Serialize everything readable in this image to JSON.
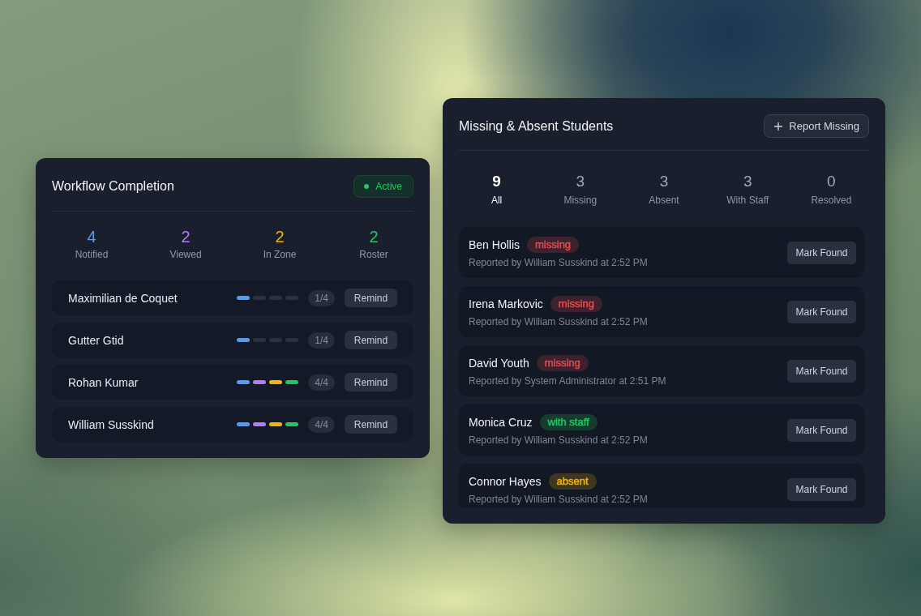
{
  "workflow": {
    "title": "Workflow Completion",
    "status": {
      "label": "Active"
    },
    "stats": [
      {
        "value": "4",
        "label": "Notified",
        "color": "#4f9df8"
      },
      {
        "value": "2",
        "label": "Viewed",
        "color": "#b07cf4"
      },
      {
        "value": "2",
        "label": "In Zone",
        "color": "#f2b20c"
      },
      {
        "value": "2",
        "label": "Roster",
        "color": "#1fc862"
      }
    ],
    "rows": [
      {
        "name": "Maximilian de Coquet",
        "steps": [
          {
            "done": true
          },
          {
            "done": false
          },
          {
            "done": false
          },
          {
            "done": false
          }
        ],
        "progress": "1/4",
        "action": "Remind"
      },
      {
        "name": "Gutter Gtid",
        "steps": [
          {
            "done": true
          },
          {
            "done": false
          },
          {
            "done": false
          },
          {
            "done": false
          }
        ],
        "progress": "1/4",
        "action": "Remind"
      },
      {
        "name": "Rohan Kumar",
        "steps": [
          {
            "done": true
          },
          {
            "done": true
          },
          {
            "done": true
          },
          {
            "done": true
          }
        ],
        "progress": "4/4",
        "action": "Remind"
      },
      {
        "name": "William Susskind",
        "steps": [
          {
            "done": true
          },
          {
            "done": true
          },
          {
            "done": true
          },
          {
            "done": true
          }
        ],
        "progress": "4/4",
        "action": "Remind"
      }
    ]
  },
  "students": {
    "title": "Missing & Absent Students",
    "action": "Report Missing",
    "filters": [
      {
        "count": "9",
        "label": "All",
        "selected": true
      },
      {
        "count": "3",
        "label": "Missing",
        "selected": false
      },
      {
        "count": "3",
        "label": "Absent",
        "selected": false
      },
      {
        "count": "3",
        "label": "With Staff",
        "selected": false
      },
      {
        "count": "0",
        "label": "Resolved",
        "selected": false
      }
    ],
    "rows": [
      {
        "name": "Ben Hollis",
        "tag": {
          "label": "missing",
          "color": "#e5484d"
        },
        "reported": "Reported by William Susskind at 2:52 PM",
        "action": "Mark Found"
      },
      {
        "name": "Irena Markovic",
        "tag": {
          "label": "missing",
          "color": "#e5484d"
        },
        "reported": "Reported by William Susskind at 2:52 PM",
        "action": "Mark Found"
      },
      {
        "name": "David Youth",
        "tag": {
          "label": "missing",
          "color": "#e5484d"
        },
        "reported": "Reported by System Administrator at 2:51 PM",
        "action": "Mark Found"
      },
      {
        "name": "Monica Cruz",
        "tag": {
          "label": "with staff",
          "color": "#22c55e"
        },
        "reported": "Reported by William Susskind at 2:52 PM",
        "action": "Mark Found"
      },
      {
        "name": "Connor Hayes",
        "tag": {
          "label": "absent",
          "color": "#f2b20c"
        },
        "reported": "Reported by William Susskind at 2:52 PM",
        "action": "Mark Found"
      }
    ]
  }
}
